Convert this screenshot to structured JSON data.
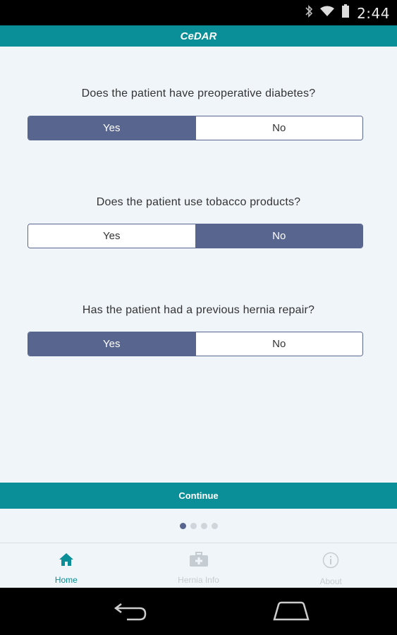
{
  "status_bar": {
    "time": "2:44",
    "icons": [
      "bluetooth-icon",
      "wifi-icon",
      "battery-icon"
    ]
  },
  "header": {
    "title": "CeDAR"
  },
  "questions": [
    {
      "text": "Does the patient have preoperative diabetes?",
      "options": [
        "Yes",
        "No"
      ],
      "selected": "Yes"
    },
    {
      "text": "Does the patient use tobacco products?",
      "options": [
        "Yes",
        "No"
      ],
      "selected": "No"
    },
    {
      "text": "Has the patient had a previous hernia repair?",
      "options": [
        "Yes",
        "No"
      ],
      "selected": "Yes"
    }
  ],
  "continue_label": "Continue",
  "pager": {
    "count": 4,
    "active": 0
  },
  "tabs": [
    {
      "label": "Home",
      "icon": "home-icon",
      "active": true
    },
    {
      "label": "Hernia Info",
      "icon": "medical-kit-icon",
      "active": false
    },
    {
      "label": "About",
      "icon": "info-icon",
      "active": false
    }
  ],
  "nav": {
    "buttons": [
      "back-icon",
      "home-nav-icon"
    ]
  },
  "colors": {
    "accent": "#0a8f98",
    "selected": "#58658f",
    "background": "#f0f5f9"
  }
}
